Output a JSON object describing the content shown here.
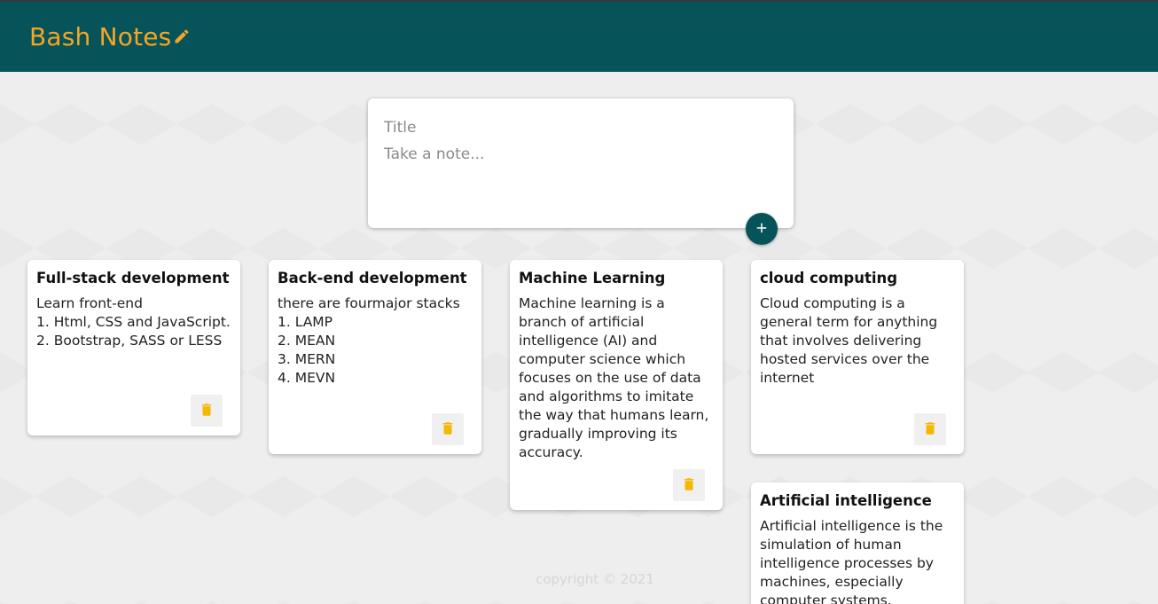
{
  "app": {
    "title": "Bash Notes",
    "title_icon": "pencil-icon",
    "accent_color": "#f5a623",
    "header_color": "#07535a"
  },
  "composer": {
    "title_placeholder": "Title",
    "content_placeholder": "Take a note...",
    "add_icon": "plus-icon"
  },
  "notes": [
    {
      "title": "Full-stack development",
      "content": "Learn front-end\n1. Html, CSS and JavaScript.\n2. Bootstrap, SASS or LESS",
      "delete_icon": "trash-icon"
    },
    {
      "title": "Back-end development",
      "content": "there are fourmajor stacks\n1. LAMP\n2. MEAN\n3. MERN\n4. MEVN",
      "delete_icon": "trash-icon"
    },
    {
      "title": "Machine Learning",
      "content": "Machine learning is a branch of artificial intelligence (AI) and computer science which focuses on the use of data and algorithms to imitate the way that humans learn, gradually improving its accuracy.",
      "delete_icon": "trash-icon"
    },
    {
      "title": "cloud computing",
      "content": "Cloud computing is a general term for anything that involves delivering hosted services over the internet",
      "delete_icon": "trash-icon"
    },
    {
      "title": "Artificial intelligence",
      "content": "Artificial intelligence is the simulation of human intelligence processes by machines, especially computer systems."
    }
  ],
  "footer": {
    "text": "copyright © 2021"
  }
}
